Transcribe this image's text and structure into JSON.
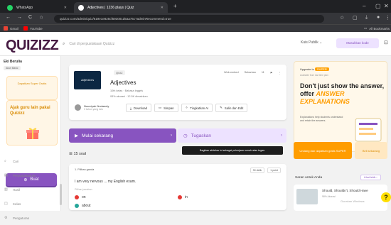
{
  "browser": {
    "tabs": [
      {
        "label": "WhatsApp",
        "icon_color": "#25d366"
      },
      {
        "label": "Adjectives | 1236 plays | Quiz",
        "icon_color": "#ffffff"
      }
    ],
    "url": "quizizz.com/admin/quiz/619e1e825cf593001d5aa75c?adminRecommend=true",
    "bookmarks": [
      {
        "label": "Gmail",
        "color": "#ea4335"
      },
      {
        "label": "YouTube",
        "color": "#ff0000"
      }
    ],
    "bookmarks_right": "All Bookmarks"
  },
  "header": {
    "logo": "QUIZIZZ",
    "search_placeholder": "Cari di perpustakaan Quizizz",
    "filter": "Kuis Publik",
    "code_button": "Masukkan kode"
  },
  "sidebar": {
    "user_name": "Eki Berulia",
    "user_badge": "Akun Basic",
    "upgrade_text": "Dapatkan Super Gratis",
    "invite_text": "Ajak guru lain pakai Quizizz",
    "create_button": "Buat",
    "nav": [
      {
        "label": "Cari",
        "icon": "search-icon"
      },
      {
        "label": "Perpustakaanku",
        "icon": "library-icon"
      },
      {
        "label": "Hasil",
        "icon": "chart-icon"
      },
      {
        "label": "Kelas",
        "icon": "class-icon"
      },
      {
        "label": "Pengaturan",
        "icon": "gear-icon"
      }
    ]
  },
  "quiz": {
    "label": "QUIZ",
    "title": "Adjectives",
    "thumb_text": "Adjectives",
    "meta_line1": "10th kelas · Bahasa Inggris",
    "meta_line2": "93% akurasi · 12.5K dimainkan",
    "top_actions": [
      "Web embed",
      "Sebarkan",
      "11"
    ],
    "author_name": "Nuurriyah Nurlaeely",
    "author_sub": "3 tahun yang lalu",
    "actions": [
      "Download",
      "Simpan",
      "Tingkatkan AI",
      "Salin dan Edit"
    ]
  },
  "buttons": {
    "start": "Mulai sekarang",
    "assign": "Tugaskan"
  },
  "tooltip": "Bagikan aktivitas ini sebagai pekerjaan rumah atau tugas.",
  "question": {
    "count": "15 soal",
    "type": "1. Pilihan ganda",
    "time": "30 detik",
    "points": "1 point",
    "text": "I am very nervous ... my English exam.",
    "choices_label": "Pilihan jawaban",
    "choices": [
      {
        "label": "on",
        "color": "#e53935"
      },
      {
        "label": "in",
        "color": "#e53935"
      },
      {
        "label": "about",
        "color": "#26a69a"
      }
    ]
  },
  "promo": {
    "upgrade": "Upgrade to",
    "super": "SUPER",
    "sub": "Available from last time plan",
    "headline_a": "Don't just show the answer, offer",
    "headline_b": "ANSWER EXPLANATIONS",
    "small": "Explanations help students understand and retain the answers.",
    "btn1": "Undang dan dapatkan gratis SUPER",
    "btn2": "Beli sekarang"
  },
  "recommend": {
    "title": "Saran untuk Anda",
    "see_more": "Lihat lebih",
    "item_title": "Should, Shouldn't, Should Have",
    "item_sub": "98% Akurasi",
    "item_sub2": "Gunakan Windows"
  },
  "help": "?"
}
